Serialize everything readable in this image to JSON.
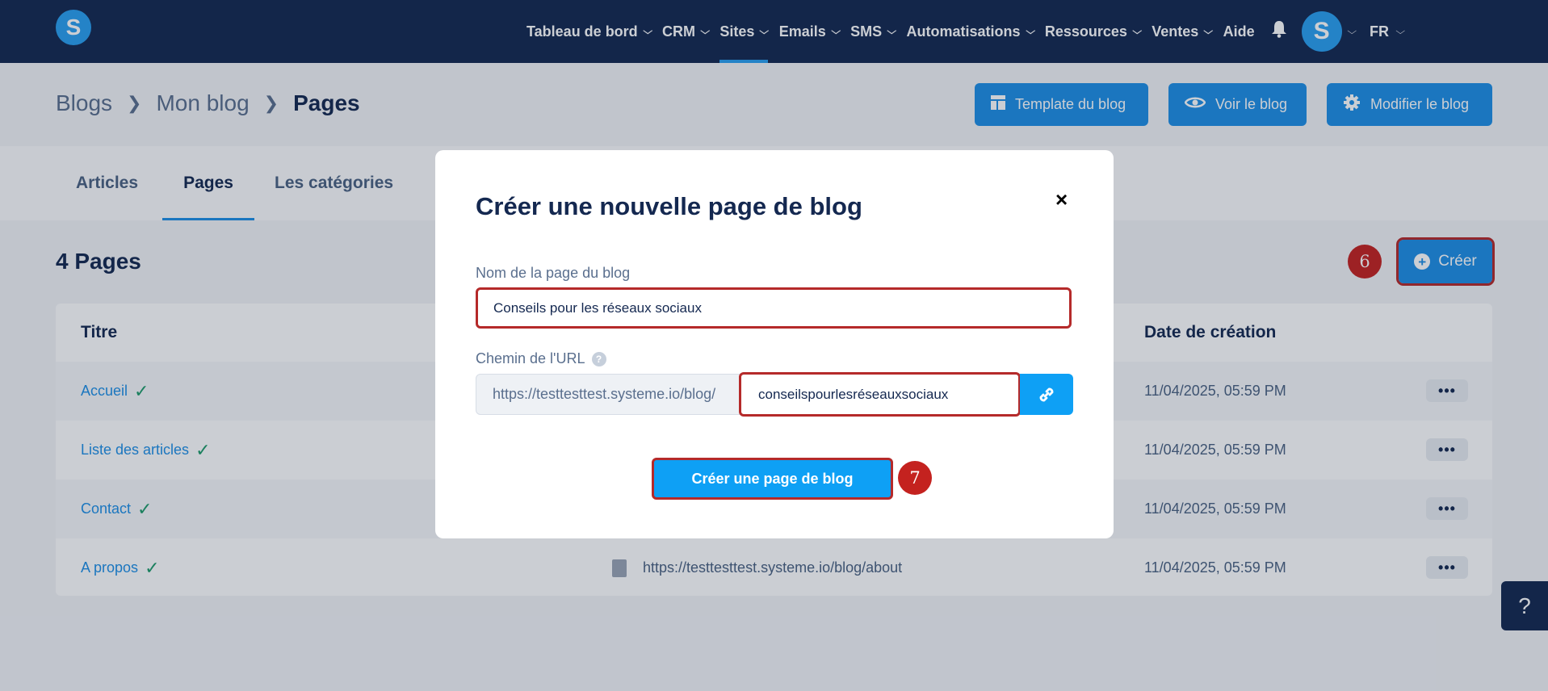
{
  "nav": {
    "items": [
      {
        "label": "Tableau de bord",
        "chevron": true,
        "active": false
      },
      {
        "label": "CRM",
        "chevron": true,
        "active": false
      },
      {
        "label": "Sites",
        "chevron": true,
        "active": true
      },
      {
        "label": "Emails",
        "chevron": true,
        "active": false
      },
      {
        "label": "SMS",
        "chevron": true,
        "active": false
      },
      {
        "label": "Automatisations",
        "chevron": true,
        "active": false
      },
      {
        "label": "Ressources",
        "chevron": true,
        "active": false
      },
      {
        "label": "Ventes",
        "chevron": true,
        "active": false
      },
      {
        "label": "Aide",
        "chevron": false,
        "active": false
      }
    ],
    "logo_letter": "S",
    "avatar_letter": "S",
    "language": "FR",
    "accent_color": "#2a9ff0",
    "bar_color": "#142850"
  },
  "breadcrumb": {
    "items": [
      "Blogs",
      "Mon blog"
    ],
    "current": "Pages"
  },
  "header_buttons": {
    "template": "Template du blog",
    "view": "Voir le blog",
    "edit": "Modifier le blog"
  },
  "tabs": {
    "articles": "Articles",
    "pages": "Pages",
    "categories": "Les catégories"
  },
  "content": {
    "count_label": "4 Pages",
    "create_label": "Créer",
    "step_create": "6",
    "step_submit": "7"
  },
  "table": {
    "headers": {
      "title": "Titre",
      "date": "Date de création"
    },
    "rows": [
      {
        "title": "Accueil",
        "url": "",
        "date": "11/04/2025, 05:59 PM"
      },
      {
        "title": "Liste des articles",
        "url": "",
        "date": "11/04/2025, 05:59 PM"
      },
      {
        "title": "Contact",
        "url": "",
        "date": "11/04/2025, 05:59 PM"
      },
      {
        "title": "A propos",
        "url": "https://testtesttest.systeme.io/blog/about",
        "date": "11/04/2025, 05:59 PM"
      }
    ]
  },
  "modal": {
    "title": "Créer une nouvelle page de blog",
    "close_glyph": "×",
    "name_label": "Nom de la page du blog",
    "name_value": "Conseils pour les réseaux sociaux",
    "url_label": "Chemin de l'URL",
    "url_help": "?",
    "url_prefix": "https://testtesttest.systeme.io/blog/",
    "url_slug": "conseilspourlesréseauxsociaux",
    "submit_label": "Créer une page de blog"
  },
  "help_glyph": "?"
}
